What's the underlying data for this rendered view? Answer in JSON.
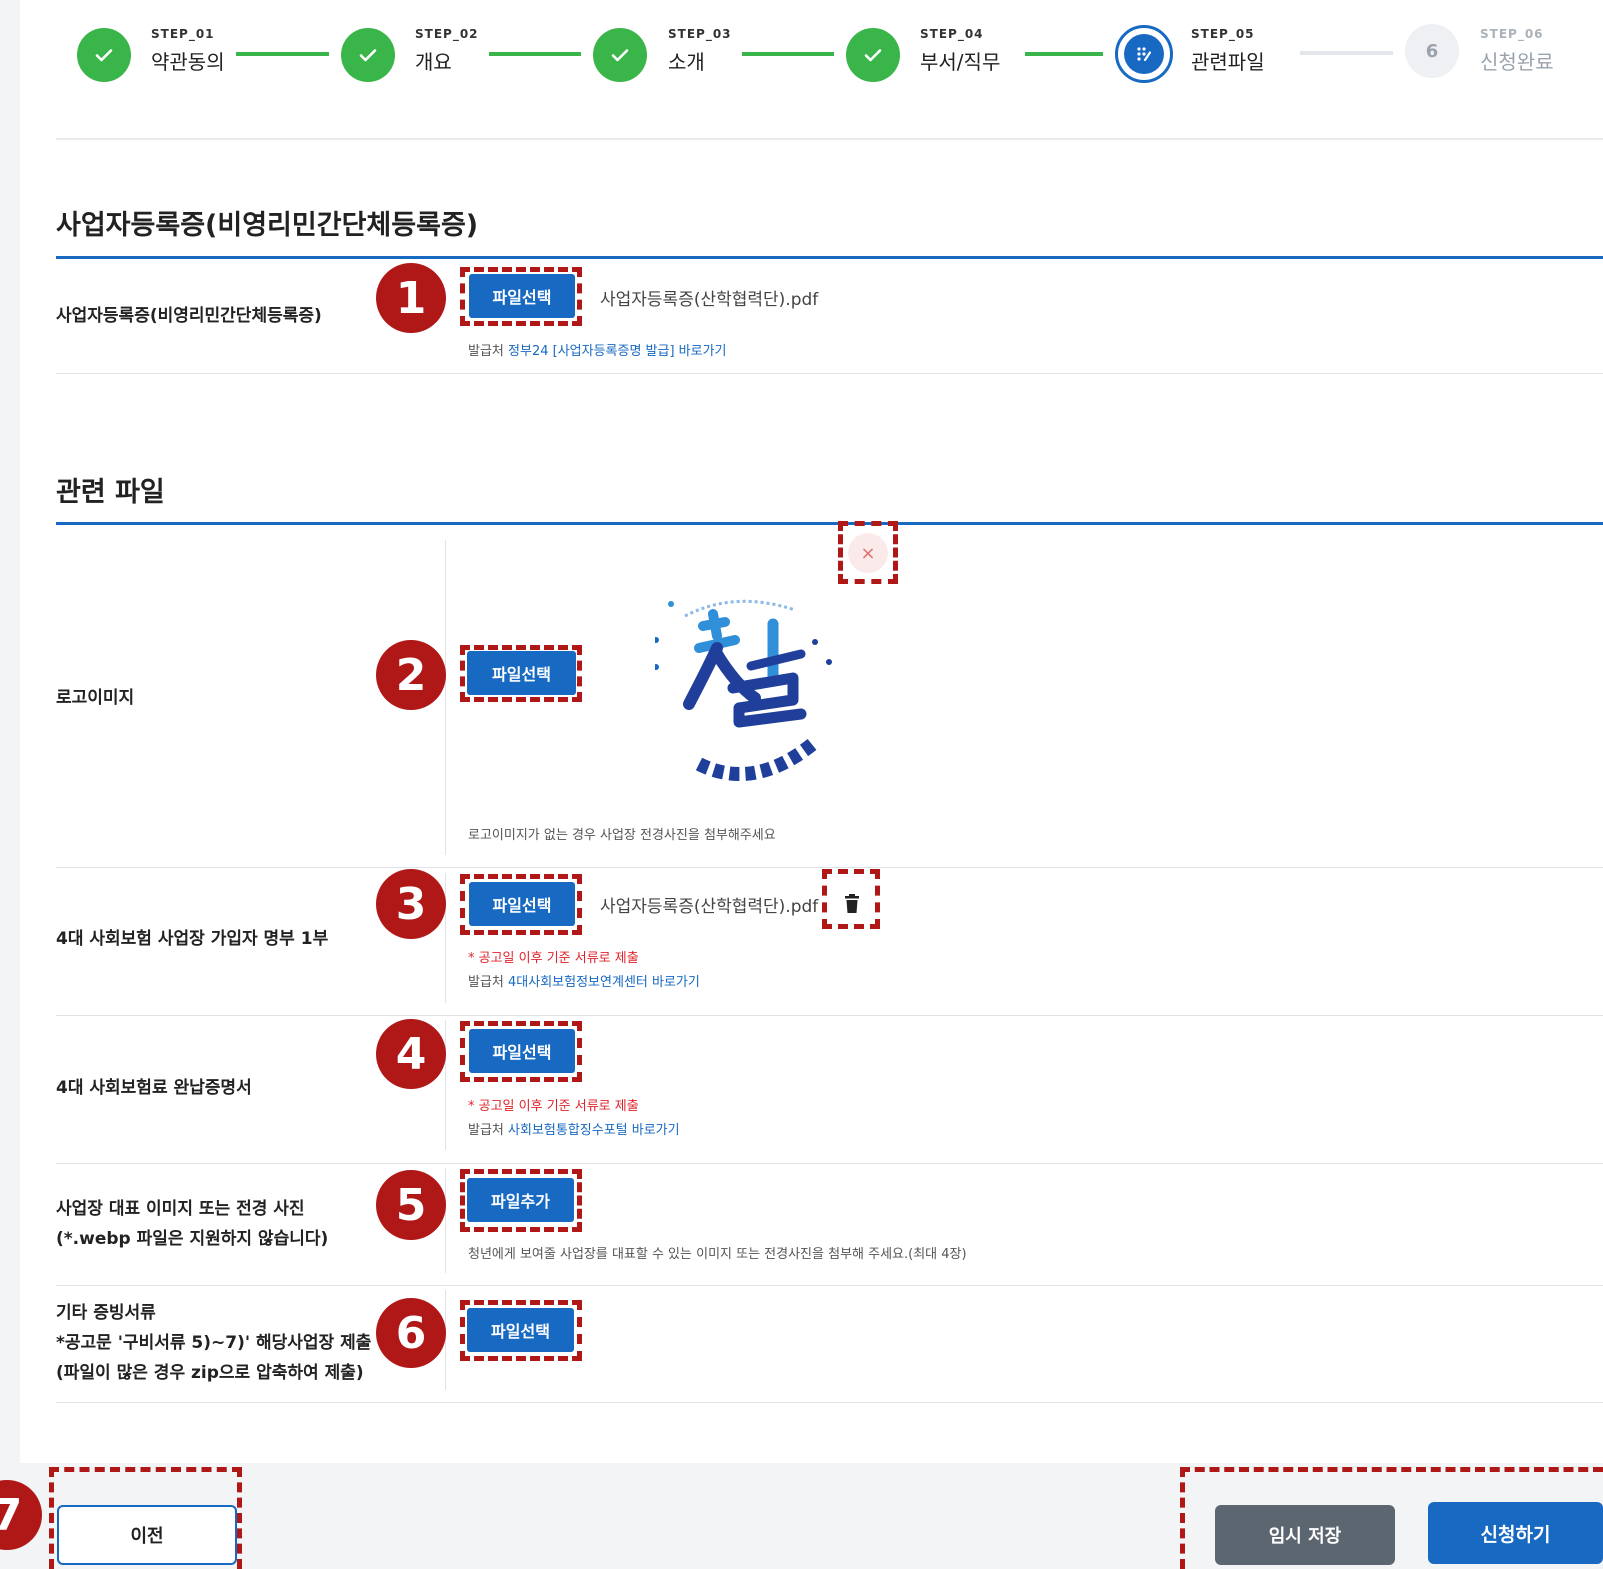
{
  "stepper": {
    "steps": [
      {
        "code": "STEP_01",
        "label": "약관동의",
        "status": "done"
      },
      {
        "code": "STEP_02",
        "label": "개요",
        "status": "done"
      },
      {
        "code": "STEP_03",
        "label": "소개",
        "status": "done"
      },
      {
        "code": "STEP_04",
        "label": "부서/직무",
        "status": "done"
      },
      {
        "code": "STEP_05",
        "label": "관련파일",
        "status": "current"
      },
      {
        "code": "STEP_06",
        "label": "신청완료",
        "status": "pending",
        "number": "6"
      }
    ]
  },
  "business_section": {
    "title": "사업자등록증(비영리민간단체등록증)",
    "row": {
      "label": "사업자등록증(비영리민간단체등록증)",
      "button": "파일선택",
      "file_name": "사업자등록증(산학협력단).pdf",
      "help_prefix": "발급처",
      "help_link": "정부24 [사업자등록증명 발급] 바로가기"
    }
  },
  "files_section": {
    "title": "관련 파일",
    "logo": {
      "label": "로고이미지",
      "button": "파일선택",
      "remove": "×",
      "help": "로고이미지가 없는 경우 사업장 전경사진을 첨부해주세요"
    },
    "insurance_list": {
      "label": "4대 사회보험 사업장 가입자 명부 1부",
      "button": "파일선택",
      "file_name": "사업자등록증(산학협력단).pdf",
      "note": "* 공고일 이후 기준 서류로 제출",
      "help_prefix": "발급처",
      "help_link": "4대사회보험정보연계센터 바로가기"
    },
    "insurance_cert": {
      "label": "4대 사회보험료 완납증명서",
      "button": "파일선택",
      "note": "* 공고일 이후 기준 서류로 제출",
      "help_prefix": "발급처",
      "help_link": "사회보험통합징수포털 바로가기"
    },
    "workplace_images": {
      "label_line1": "사업장 대표 이미지 또는 전경 사진",
      "label_line2": "(*.webp 파일은 지원하지 않습니다)",
      "button": "파일추가",
      "help": "청년에게 보여줄 사업장를 대표할 수 있는 이미지 또는 전경사진을 첨부해 주세요.(최대 4장)"
    },
    "other_docs": {
      "label_line1": "기타 증빙서류",
      "label_line2": "*공고문 '구비서류 5)~7)' 해당사업장 제출",
      "label_line3": "(파일이 많은 경우 zip으로 압축하여 제출)",
      "button": "파일선택"
    }
  },
  "annotations": [
    "1",
    "2",
    "3",
    "4",
    "5",
    "6",
    "7"
  ],
  "footer": {
    "prev": "이전",
    "temp_save": "임시 저장",
    "submit": "신청하기"
  },
  "colors": {
    "primary": "#1769c2",
    "done": "#3ab54a",
    "annotation": "#b01818",
    "note_red": "#e0242b"
  }
}
